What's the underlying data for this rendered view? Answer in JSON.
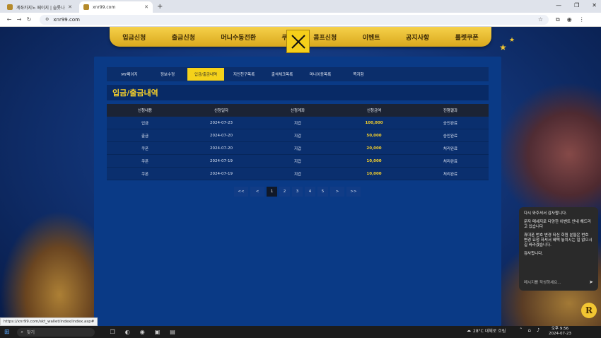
{
  "browser": {
    "tabs": [
      {
        "label": "계좌카지노 페이지 | 슬롯나라",
        "active": false
      },
      {
        "label": "xnr99.com",
        "active": true
      }
    ],
    "url": "xnr99.com",
    "status_url": "https://xnr99.com/skt_wallet/index/index.asp#"
  },
  "menu": {
    "items": [
      "입금신청",
      "출금신청",
      "머니수동전환",
      "쿠",
      "콤프신청",
      "이벤트",
      "공지사항",
      "룰렛쿠폰"
    ]
  },
  "subtabs": [
    {
      "label": "MY페이지",
      "active": false
    },
    {
      "label": "정보수정",
      "active": false
    },
    {
      "label": "입금/출금내역",
      "active": true
    },
    {
      "label": "지인친구목록",
      "active": false
    },
    {
      "label": "출석체크목록",
      "active": false
    },
    {
      "label": "머니이동목록",
      "active": false
    },
    {
      "label": "쪽지함",
      "active": false
    }
  ],
  "page_title": "입금/출금내역",
  "table": {
    "headers": [
      "신청내용",
      "신청일자",
      "신청계좌",
      "신청금액",
      "진행결과"
    ],
    "rows": [
      [
        "입금",
        "2024-07-23",
        "지갑",
        "100,000",
        "승인완료"
      ],
      [
        "출금",
        "2024-07-20",
        "지갑",
        "50,000",
        "승인완료"
      ],
      [
        "쿠폰",
        "2024-07-20",
        "지갑",
        "20,000",
        "처리완료"
      ],
      [
        "쿠폰",
        "2024-07-19",
        "지갑",
        "10,000",
        "처리완료"
      ],
      [
        "쿠폰",
        "2024-07-19",
        "지갑",
        "10,000",
        "처리완료"
      ]
    ]
  },
  "pagination": {
    "first": "<<",
    "prev": "<",
    "next": ">",
    "last": ">>",
    "pages": [
      "1",
      "2",
      "3",
      "4",
      "5"
    ],
    "current": "1"
  },
  "chat": {
    "messages": [
      "다시 와주셔서 감사합니다.",
      "문자 메세지로 다양한 이벤트 안내 해드리고 있습니다",
      "휴대폰 번호 변경 되신 회원 분들은 번호 변경 요청 하셔서 혜택 놓치시는 일 없으시길 바라겠습니다.",
      "감사합니다."
    ],
    "input_placeholder": "메시지를 작성하세요...",
    "bubble_letter": "R"
  },
  "taskbar": {
    "search": "찾기",
    "weather": "28°C  대체로 흐림",
    "time": "오후 9:56",
    "date": "2024-07-23"
  },
  "colors": {
    "menu_gold": "#f5cf2a",
    "panel_blue": "#0a3a86",
    "amount_gold": "#f5cf2a",
    "active_tab": "#f5d21a"
  }
}
